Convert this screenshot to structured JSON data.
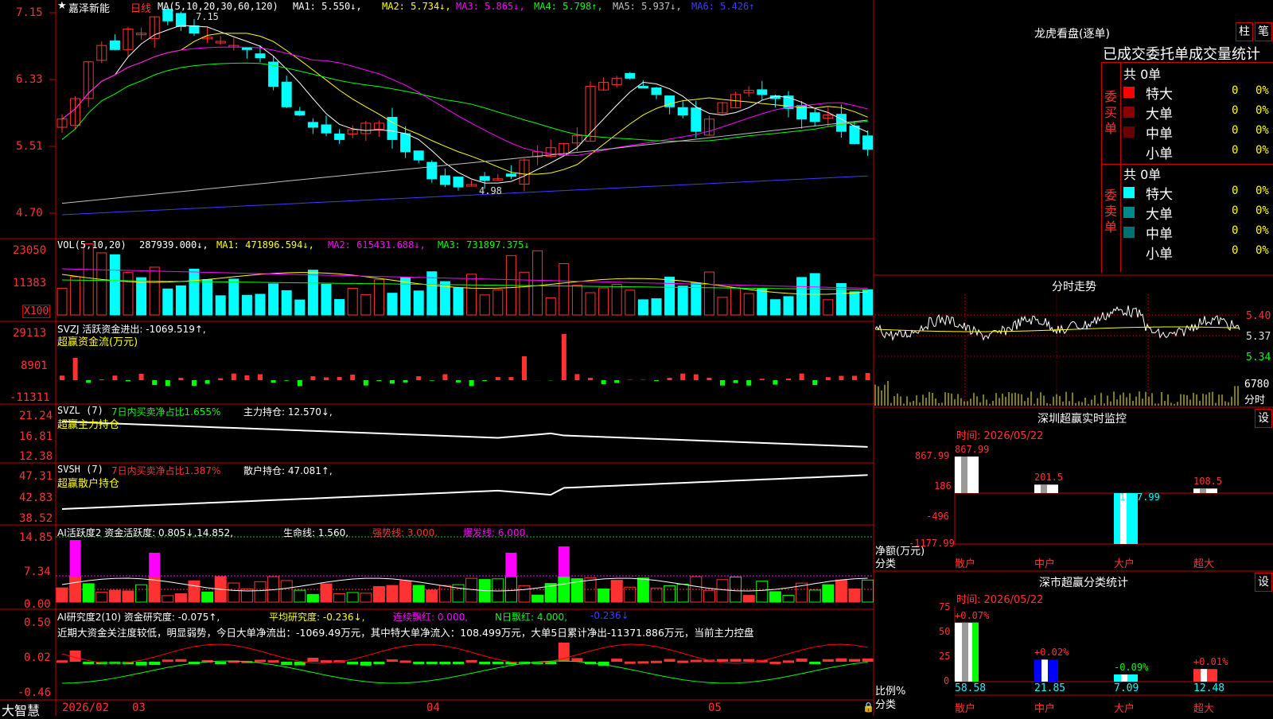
{
  "stock": {
    "name": "嘉泽新能",
    "period": "日线"
  },
  "header": {
    "ma_title": "MA(5,10,20,30,60,120)",
    "ma1": "MA1: 5.550↓,",
    "ma2": "MA2: 5.734↓,",
    "ma3": "MA3: 5.865↓,",
    "ma4": "MA4: 5.798↑,",
    "ma5": "MA5: 5.937↓,",
    "ma6": "MA6: 5.426↑",
    "hi_label": "7.15",
    "lo_label": "4.98"
  },
  "price_axis": [
    "7.15",
    "6.33",
    "5.51",
    "4.70"
  ],
  "vol": {
    "title": "VOL(5,10,20)",
    "value": "287939.000↓,",
    "ma1": "MA1: 471896.594↓,",
    "ma2": "MA2: 615431.688↓,",
    "ma3": "MA3: 731897.375↓",
    "axis": [
      "23050",
      "11383",
      "X100"
    ]
  },
  "svzj": {
    "title": "SVZJ  活跃资金进出: -1069.519↑,",
    "sub": "超赢资金流(万元)",
    "axis": [
      "29113",
      "8901",
      "-11311"
    ]
  },
  "svzl": {
    "title": "SVZL (7)",
    "t2": "7日内买卖净占比1.655%",
    "t3": "主力持仓: 12.570↓,",
    "sub": "超赢主力持仓",
    "axis": [
      "21.24",
      "16.81",
      "12.38"
    ]
  },
  "svsh": {
    "title": "SVSH (7)",
    "t2": "7日内买卖净占比1.387%",
    "t3": "散户持仓: 47.081↑,",
    "sub": "超赢散户持仓",
    "axis": [
      "47.31",
      "42.83",
      "38.52"
    ]
  },
  "ai_active": {
    "t1": "AI活跃度2 资金活跃度: 0.805↓,14.852,",
    "t2": "生命线: 1.560,",
    "t3": "强势线: 3.000,",
    "t4": "爆发线: 6.000,",
    "axis": [
      "14.85",
      "7.34",
      "0.00"
    ]
  },
  "ai_research": {
    "t1": "AI研究度2(10) 资金研究度: -0.075↑,",
    "t2": "平均研究度: -0.236↓,",
    "t3": "连续飘红: 0.000,",
    "t4": "N日飘红: 4.000,",
    "t5": "-0.236↓",
    "commentary": "近期大资金关注度较低，明显弱势，今日大单净流出：-1069.49万元，其中特大单净流入：108.499万元，大单5日累计净出-11371.886万元，当前主力控盘",
    "axis": [
      "0.50",
      "0.02",
      "-0.46"
    ]
  },
  "timeline": {
    "brand": "大智慧",
    "labels": [
      "2026/02",
      "03",
      "04",
      "05"
    ]
  },
  "lhb": {
    "title": "龙虎看盘(逐单)",
    "btn1": "柱",
    "btn2": "笔",
    "heading": "已成交委托单成交量统计",
    "buy": {
      "side": "委买单",
      "total": "共 0单",
      "rows": [
        {
          "label": "特大",
          "count": "0",
          "pct": "0%",
          "color": "#ff0000"
        },
        {
          "label": "大单",
          "count": "0",
          "pct": "0%",
          "color": "#8b0000"
        },
        {
          "label": "中单",
          "count": "0",
          "pct": "0%",
          "color": "#6b0000"
        },
        {
          "label": "小单",
          "count": "0",
          "pct": "0%",
          "color": "#000000"
        }
      ]
    },
    "sell": {
      "side": "委卖单",
      "total": "共 0单",
      "rows": [
        {
          "label": "特大",
          "count": "0",
          "pct": "0%",
          "color": "#00ffff"
        },
        {
          "label": "大单",
          "count": "0",
          "pct": "0%",
          "color": "#008b8b"
        },
        {
          "label": "中单",
          "count": "0",
          "pct": "0%",
          "color": "#007070"
        },
        {
          "label": "小单",
          "count": "0",
          "pct": "0%",
          "color": "#000000"
        }
      ]
    }
  },
  "intraday": {
    "title": "分时走势",
    "axis": [
      "5.40",
      "5.37",
      "5.34"
    ],
    "vol": "6780",
    "unit": "分时"
  },
  "monitor": {
    "title": "深圳超赢实时监控",
    "btn": "设",
    "date": "时间: 2026/05/22",
    "axis": [
      "867.99",
      "186",
      "-496",
      "-1177.99"
    ],
    "unit": "净额(万元)",
    "cat": "分类",
    "bars": [
      {
        "label": "散户",
        "value": 867.99,
        "text": "867.99"
      },
      {
        "label": "中户",
        "value": 201.5,
        "text": "201.5"
      },
      {
        "label": "大户",
        "value": -1177.99,
        "text": "-1177.99"
      },
      {
        "label": "超大",
        "value": 108.5,
        "text": "108.5"
      }
    ]
  },
  "classify": {
    "title": "深市超赢分类统计",
    "btn": "设",
    "date": "时间: 2026/05/22",
    "axis": [
      "75",
      "50",
      "25",
      "0"
    ],
    "unit": "比例%",
    "cat": "分类",
    "bars": [
      {
        "label": "散户",
        "value": 58.58,
        "text": "58.58",
        "chg": "+0.07%"
      },
      {
        "label": "中户",
        "value": 21.85,
        "text": "21.85",
        "chg": "+0.02%"
      },
      {
        "label": "大户",
        "value": 7.09,
        "text": "7.09",
        "chg": "-0.09%"
      },
      {
        "label": "超大",
        "value": 12.48,
        "text": "12.48",
        "chg": "+0.01%"
      }
    ]
  },
  "colors": {
    "up": "#ff3232",
    "down": "#00ffff",
    "frame": "#c00000",
    "ma1": "#ffffff",
    "ma2": "#ffff00",
    "ma3": "#ff00ff",
    "ma4": "#00ff00",
    "ma5": "#c0c0c0",
    "ma6": "#3c3cff"
  }
}
